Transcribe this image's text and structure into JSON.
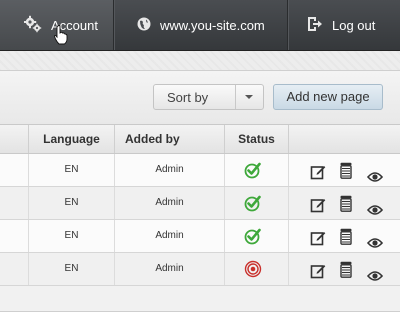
{
  "nav": {
    "account": "Account",
    "site": "www.you-site.com",
    "logout": "Log out"
  },
  "toolbar": {
    "sort_label": "Sort by",
    "add_label": "Add new page"
  },
  "table": {
    "headers": {
      "language": "Language",
      "added_by": "Added by",
      "status": "Status"
    },
    "rows": [
      {
        "language": "EN",
        "added_by": "Admin",
        "status": "published"
      },
      {
        "language": "EN",
        "added_by": "Admin",
        "status": "published"
      },
      {
        "language": "EN",
        "added_by": "Admin",
        "status": "published"
      },
      {
        "language": "EN",
        "added_by": "Admin",
        "status": "unpublished"
      }
    ]
  },
  "icons": {
    "account": "gear-icon",
    "site": "globe-icon",
    "logout": "logout-icon",
    "actions": [
      "edit-icon",
      "delete-icon",
      "view-icon"
    ]
  },
  "colors": {
    "published": "#3ea83a",
    "unpublished": "#c9302c"
  }
}
